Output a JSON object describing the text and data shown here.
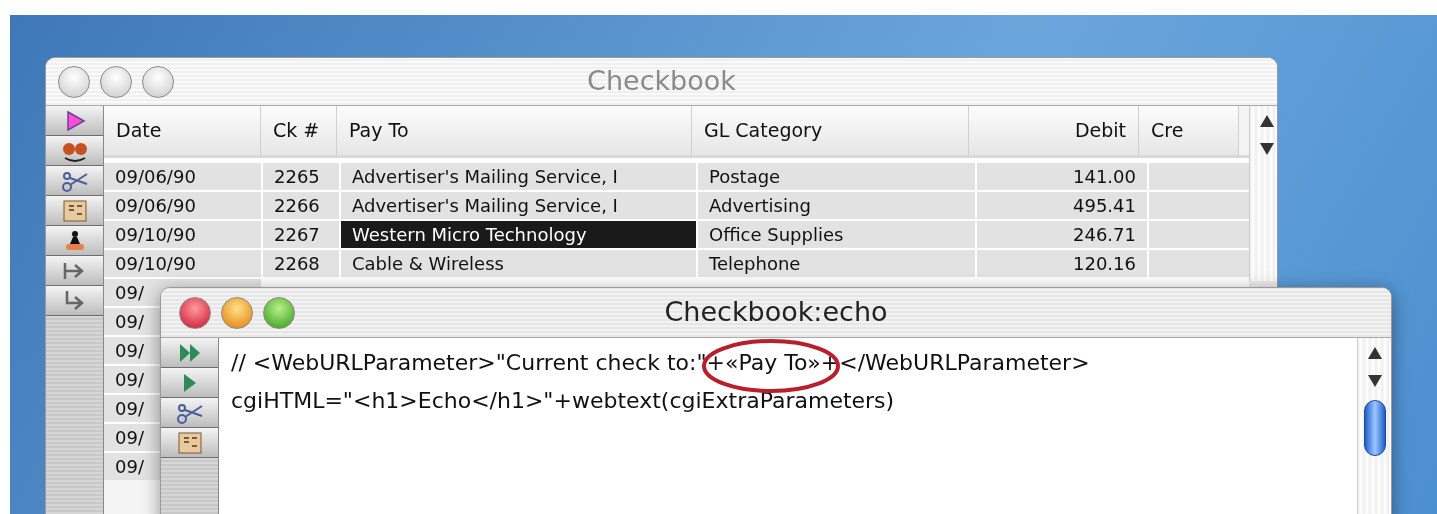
{
  "back_window": {
    "title": "Checkbook",
    "active": false,
    "tools": [
      {
        "kind": "pointer"
      },
      {
        "kind": "faces"
      },
      {
        "kind": "scissors"
      },
      {
        "kind": "form"
      },
      {
        "kind": "stamp"
      },
      {
        "kind": "tab-right"
      },
      {
        "kind": "return"
      }
    ],
    "table": {
      "columns": [
        "Date",
        "Ck #",
        "Pay To",
        "GL Category",
        "Debit",
        "Cre"
      ],
      "rows": [
        {
          "cells": [
            {
              "text": "09/06/90",
              "selected": false
            },
            {
              "text": "2265",
              "selected": false
            },
            {
              "text": "Advertiser's Mailing Service, I",
              "selected": false
            },
            {
              "text": "Postage",
              "selected": false
            },
            {
              "text": "141.00",
              "selected": false
            },
            {
              "text": "",
              "selected": false
            }
          ]
        },
        {
          "cells": [
            {
              "text": "09/06/90",
              "selected": false
            },
            {
              "text": "2266",
              "selected": false
            },
            {
              "text": "Advertiser's Mailing Service, I",
              "selected": false
            },
            {
              "text": "Advertising",
              "selected": false
            },
            {
              "text": "495.41",
              "selected": false
            },
            {
              "text": "",
              "selected": false
            }
          ]
        },
        {
          "cells": [
            {
              "text": "09/10/90",
              "selected": false
            },
            {
              "text": "2267",
              "selected": false
            },
            {
              "text": "Western Micro Technology",
              "selected": true
            },
            {
              "text": "Office Supplies",
              "selected": false
            },
            {
              "text": "246.71",
              "selected": false
            },
            {
              "text": "",
              "selected": false
            }
          ]
        },
        {
          "cells": [
            {
              "text": "09/10/90",
              "selected": false
            },
            {
              "text": "2268",
              "selected": false
            },
            {
              "text": "Cable & Wireless",
              "selected": false
            },
            {
              "text": "Telephone",
              "selected": false
            },
            {
              "text": "120.16",
              "selected": false
            },
            {
              "text": "",
              "selected": false
            }
          ]
        },
        {
          "cells": [
            {
              "text": "09/",
              "selected": false
            }
          ]
        },
        {
          "cells": [
            {
              "text": "09/",
              "selected": false
            }
          ]
        },
        {
          "cells": [
            {
              "text": "09/",
              "selected": false
            }
          ]
        },
        {
          "cells": [
            {
              "text": "09/",
              "selected": false
            }
          ]
        },
        {
          "cells": [
            {
              "text": "09/",
              "selected": false
            }
          ]
        },
        {
          "cells": [
            {
              "text": "09/",
              "selected": false
            }
          ]
        },
        {
          "cells": [
            {
              "text": "09/",
              "selected": false
            }
          ]
        }
      ]
    }
  },
  "front_window": {
    "title": "Checkbook:echo",
    "active": true,
    "tools": [
      {
        "kind": "run-all"
      },
      {
        "kind": "run"
      },
      {
        "kind": "scissors"
      },
      {
        "kind": "form"
      }
    ],
    "code_lines": [
      [
        {
          "text": "// <WebURLParameter>\"Current check to:\"+",
          "circled": false
        },
        {
          "text": "«Pay To»",
          "circled": true
        },
        {
          "text": "+</WebURLParameter>",
          "circled": false
        }
      ],
      [
        {
          "text": "cgiHTML=\"<h1>Echo</h1>\"+webtext(cgiExtraParameters)",
          "circled": false
        }
      ]
    ]
  }
}
